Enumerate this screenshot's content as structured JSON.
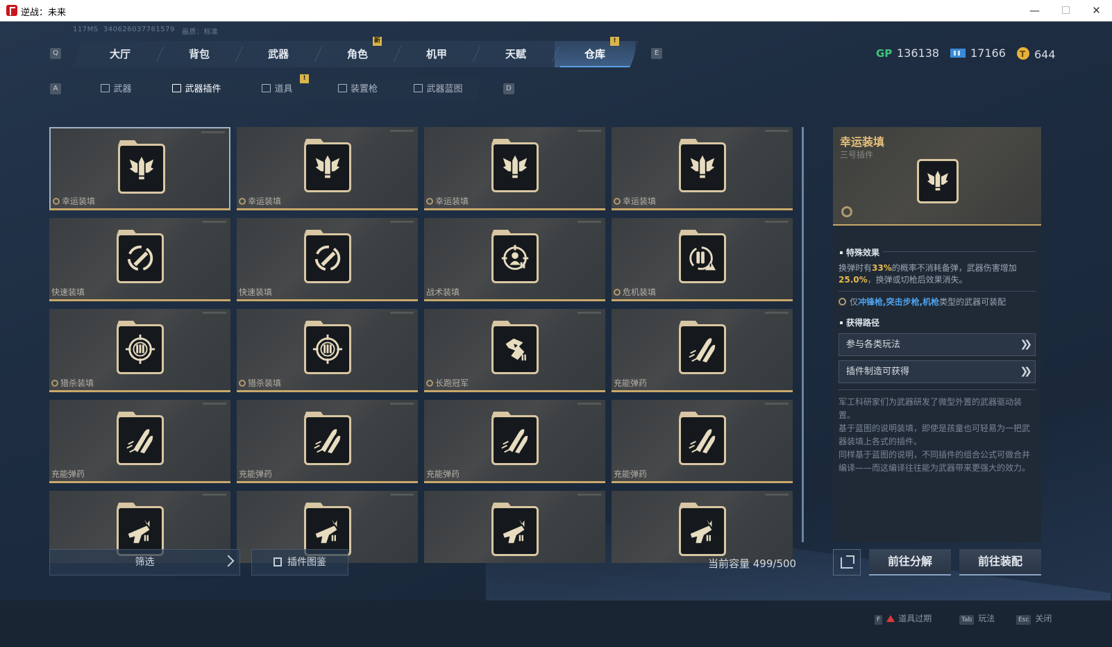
{
  "window": {
    "title": "逆战：未来"
  },
  "meta": {
    "ping": "117MS",
    "uid": "340626037761579",
    "quality": "画质：标准"
  },
  "keys": {
    "q": "Q",
    "e": "E",
    "a": "A",
    "d": "D"
  },
  "main_tabs": [
    {
      "label": "大厅"
    },
    {
      "label": "背包"
    },
    {
      "label": "武器"
    },
    {
      "label": "角色",
      "badge": "新"
    },
    {
      "label": "机甲"
    },
    {
      "label": "天赋"
    },
    {
      "label": "仓库",
      "active": true,
      "badge": "!"
    }
  ],
  "sub_tabs": [
    {
      "label": "武器"
    },
    {
      "label": "武器插件",
      "active": true
    },
    {
      "label": "道具",
      "badge": "!"
    },
    {
      "label": "装置枪"
    },
    {
      "label": "武器蓝图"
    }
  ],
  "currency": [
    {
      "icon": "gp-icon",
      "value": "136138"
    },
    {
      "icon": "ticket-icon",
      "value": "17166"
    },
    {
      "icon": "coin-icon",
      "value": "644"
    }
  ],
  "items": [
    {
      "name": "幸运装填",
      "icon": "winged-bullet-icon",
      "cog": true,
      "selected": true
    },
    {
      "name": "幸运装填",
      "icon": "winged-bullet-icon",
      "cog": true
    },
    {
      "name": "幸运装填",
      "icon": "winged-bullet-icon",
      "cog": true
    },
    {
      "name": "幸运装填",
      "icon": "winged-bullet-icon",
      "cog": true
    },
    {
      "name": "快速装填",
      "icon": "fast-reload-icon",
      "cog": false
    },
    {
      "name": "快速装填",
      "icon": "fast-reload-icon",
      "cog": false
    },
    {
      "name": "战术装填",
      "icon": "tactical-reload-icon",
      "cog": false
    },
    {
      "name": "危机装填",
      "icon": "crisis-reload-icon",
      "cog": true
    },
    {
      "name": "猎杀装填",
      "icon": "crosshair-ammo-icon",
      "cog": true
    },
    {
      "name": "猎杀装填",
      "icon": "crosshair-ammo-icon",
      "cog": true
    },
    {
      "name": "长跑冠军",
      "icon": "runner-icon",
      "cog": true
    },
    {
      "name": "充能弹药",
      "icon": "charged-ammo-icon",
      "cog": false
    },
    {
      "name": "充能弹药",
      "icon": "charged-ammo-icon",
      "cog": false
    },
    {
      "name": "充能弹药",
      "icon": "charged-ammo-icon",
      "cog": false
    },
    {
      "name": "充能弹药",
      "icon": "charged-ammo-icon",
      "cog": false
    },
    {
      "name": "充能弹药",
      "icon": "charged-ammo-icon",
      "cog": false
    },
    {
      "name": "",
      "icon": "gun-ammo-icon",
      "cog": false
    },
    {
      "name": "",
      "icon": "gun-ammo-icon",
      "cog": false
    },
    {
      "name": "",
      "icon": "gun-ammo-icon",
      "cog": false
    },
    {
      "name": "",
      "icon": "gun-ammo-icon",
      "cog": false
    }
  ],
  "bottom": {
    "filter": "筛选",
    "codex": "插件图鉴",
    "capacity": "当前容量 499/500"
  },
  "detail": {
    "name": "幸运装填",
    "subtitle": "三号插件",
    "effect_title": "特殊效果",
    "effect_parts": [
      "换弹时有",
      "33%",
      "的概率不消耗备弹，武器伤害增加",
      "25.0%",
      "，换弹或切枪后效果消失。"
    ],
    "compat_parts": [
      "仅",
      "冲锋枪,突击步枪,机枪",
      "类型的武器可装配"
    ],
    "source_title": "获得路径",
    "sources": [
      "参与各类玩法",
      "插件制造可获得"
    ],
    "lore": [
      "军工科研家们为武器研发了微型外置的武器驱动装置。",
      "基于蓝图的说明装填，即使是孩童也可轻易为一把武器装填上各式的插件。",
      "同样基于蓝图的说明，不同插件的组合公式可做合并编译——而这编译往往能为武器带来更强大的效力。"
    ]
  },
  "actions": {
    "decompose": "前往分解",
    "equip": "前往装配"
  },
  "footer": [
    {
      "key": "F",
      "label": "道具过期",
      "warn": true
    },
    {
      "key": "Tab",
      "label": "玩法"
    },
    {
      "key": "Esc",
      "label": "关闭"
    }
  ],
  "colors": {
    "gold": "#c9a86a",
    "accent_blue": "#4ea3f0",
    "highlight": "#e8b94f"
  }
}
